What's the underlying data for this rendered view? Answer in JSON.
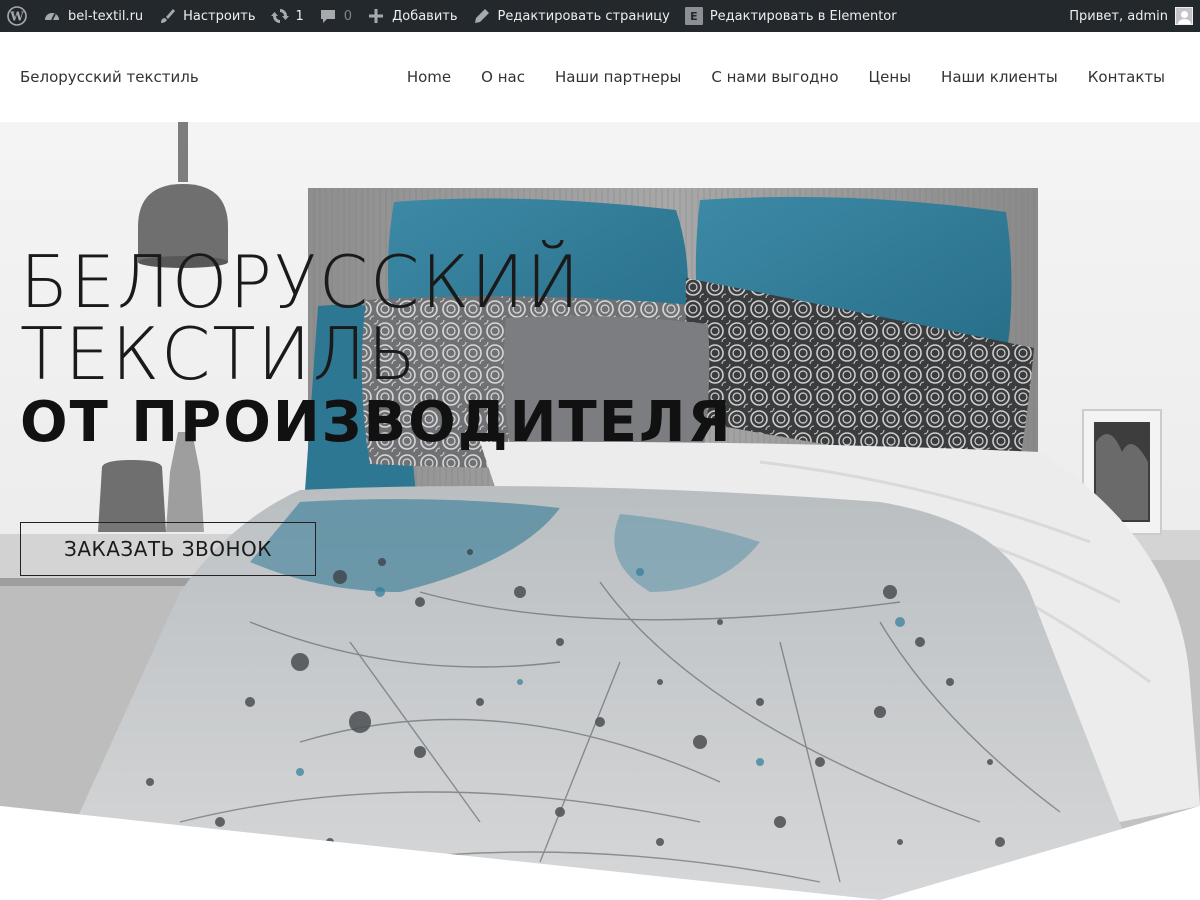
{
  "adminbar": {
    "wp_logo_icon": "wordpress-logo-icon",
    "site_name": "bel-textil.ru",
    "customize": "Настроить",
    "updates_count": "1",
    "comments_count": "0",
    "add_new": "Добавить",
    "edit_page": "Редактировать страницу",
    "edit_elementor": "Редактировать в Elementor",
    "elementor_icon_letter": "E",
    "greeting": "Привет, admin"
  },
  "header": {
    "site_title": "Белорусский текстиль",
    "nav": [
      {
        "label": "Home"
      },
      {
        "label": "О нас"
      },
      {
        "label": "Наши партнеры"
      },
      {
        "label": "С нами выгодно"
      },
      {
        "label": "Цены"
      },
      {
        "label": "Наши клиенты"
      },
      {
        "label": "Контакты"
      }
    ]
  },
  "hero": {
    "headline_line1": "БЕЛОРУССКИЙ",
    "headline_line2": "ТЕКСТИЛЬ",
    "headline_bold": "ОТ ПРОИЗВОДИТЕЛЯ",
    "cta_label": "ЗАКАЗАТЬ ЗВОНОК"
  },
  "colors": {
    "adminbar_bg": "#23282d",
    "adminbar_text": "#eeeeee",
    "header_bg": "#ffffff",
    "text_dark": "#1a1a1a",
    "accent_teal": "#2f7c99"
  }
}
